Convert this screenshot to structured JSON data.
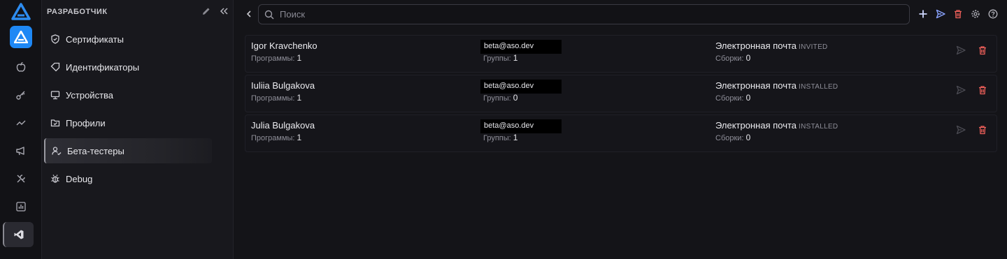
{
  "sidebar": {
    "title": "РАЗРАБОТЧИК",
    "items": [
      {
        "label": "Сертификаты",
        "icon": "shield-icon"
      },
      {
        "label": "Идентификаторы",
        "icon": "tag-icon"
      },
      {
        "label": "Устройства",
        "icon": "monitor-icon"
      },
      {
        "label": "Профили",
        "icon": "folder-check-icon"
      },
      {
        "label": "Бета-тестеры",
        "icon": "user-check-icon",
        "active": true
      },
      {
        "label": "Debug",
        "icon": "bug-icon"
      }
    ]
  },
  "search": {
    "placeholder": "Поиск"
  },
  "colors": {
    "accent": "#1e88f5",
    "danger": "#f0605a",
    "send": "#8aa4ff"
  },
  "testers": [
    {
      "name": "Igor Kravchenko",
      "programs_label": "Программы:",
      "programs": "1",
      "email": "beta@aso.dev",
      "groups_label": "Группы:",
      "groups": "1",
      "type": "Электронная почта",
      "status": "INVITED",
      "builds_label": "Сборки:",
      "builds": "0"
    },
    {
      "name": "Iuliia Bulgakova",
      "programs_label": "Программы:",
      "programs": "1",
      "email": "beta@aso.dev",
      "groups_label": "Группы:",
      "groups": "0",
      "type": "Электронная почта",
      "status": "INSTALLED",
      "builds_label": "Сборки:",
      "builds": "0"
    },
    {
      "name": "Julia Bulgakova",
      "programs_label": "Программы:",
      "programs": "1",
      "email": "beta@aso.dev",
      "groups_label": "Группы:",
      "groups": "1",
      "type": "Электронная почта",
      "status": "INSTALLED",
      "builds_label": "Сборки:",
      "builds": "0"
    }
  ]
}
